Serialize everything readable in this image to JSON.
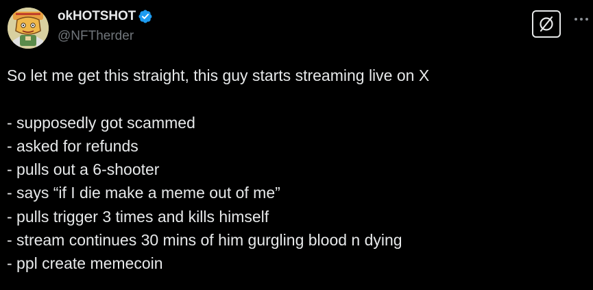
{
  "author": {
    "display_name": "okHOTSHOT",
    "handle": "@NFTherder",
    "verified": true,
    "avatar_icon": "cartoon-avatar"
  },
  "actions": {
    "grok_icon": "grok-icon",
    "more_icon": "more-options-icon"
  },
  "tweet": {
    "intro": "So let me get this straight, this guy starts streaming live on X",
    "points": [
      "- supposedly got scammed",
      "- asked for refunds",
      "- pulls out a 6-shooter",
      "- says “if I die make a meme out of me”",
      "- pulls trigger 3 times and kills himself",
      "- stream continues 30 mins of him gurgling blood n dying",
      "- ppl create memecoin"
    ]
  },
  "colors": {
    "background": "#000000",
    "text": "#e7e9ea",
    "secondary_text": "#71767b",
    "verified_blue": "#1d9bf0"
  }
}
